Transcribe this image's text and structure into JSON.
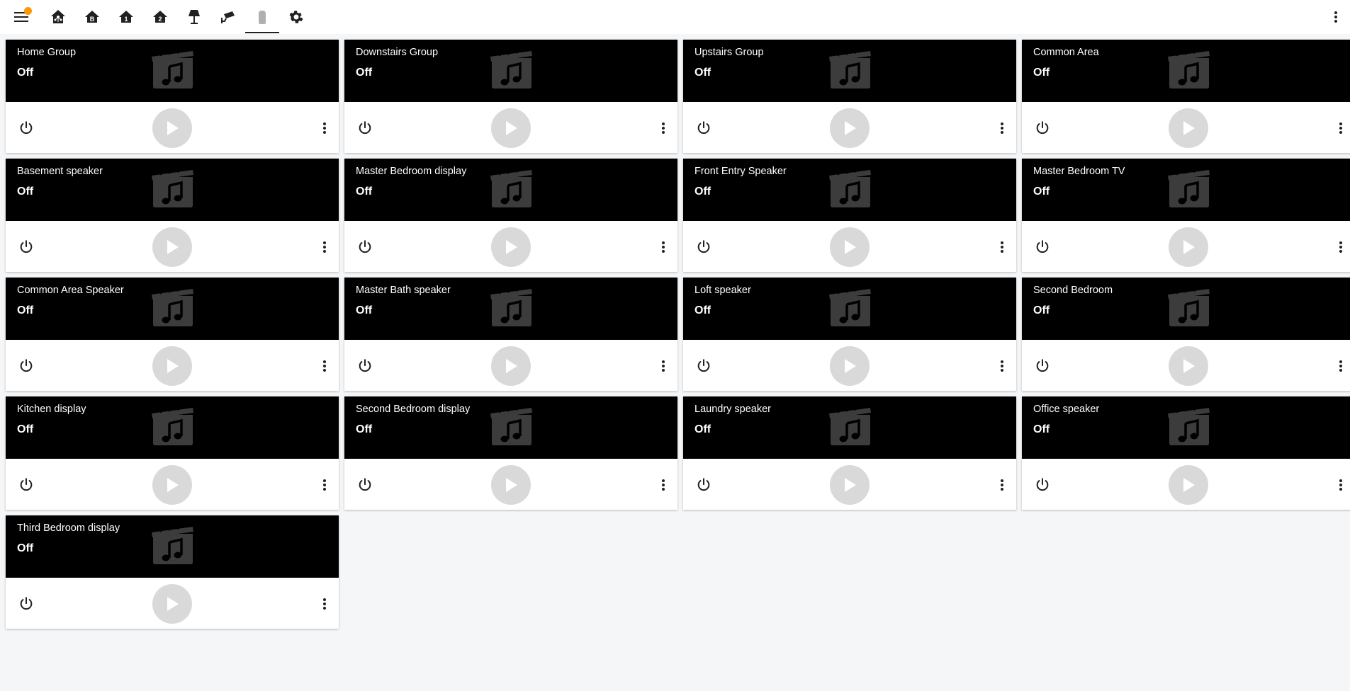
{
  "toolbar": {
    "menu_icon": "menu-icon",
    "has_notification_badge": true,
    "badge_color": "#ff9800",
    "tabs": [
      {
        "icon": "home-assistant-icon",
        "active": false
      },
      {
        "icon": "home-floor-b-icon",
        "active": false
      },
      {
        "icon": "home-floor-1-icon",
        "active": false
      },
      {
        "icon": "home-floor-2-icon",
        "active": false
      },
      {
        "icon": "floor-lamp-icon",
        "active": false
      },
      {
        "icon": "cctv-icon",
        "active": false
      },
      {
        "icon": "speaker-icon",
        "active": true
      },
      {
        "icon": "gear-icon",
        "active": false
      }
    ],
    "overflow_icon": "dots-vertical-icon"
  },
  "media_players": [
    {
      "name": "Home Group",
      "state": "Off"
    },
    {
      "name": "Downstairs Group",
      "state": "Off"
    },
    {
      "name": "Upstairs Group",
      "state": "Off"
    },
    {
      "name": "Common Area",
      "state": "Off"
    },
    {
      "name": "Basement speaker",
      "state": "Off"
    },
    {
      "name": "Master Bedroom display",
      "state": "Off"
    },
    {
      "name": "Front Entry Speaker",
      "state": "Off"
    },
    {
      "name": "Master Bedroom TV",
      "state": "Off"
    },
    {
      "name": "Common Area Speaker",
      "state": "Off"
    },
    {
      "name": "Master Bath speaker",
      "state": "Off"
    },
    {
      "name": "Loft speaker",
      "state": "Off"
    },
    {
      "name": "Second Bedroom",
      "state": "Off"
    },
    {
      "name": "Kitchen display",
      "state": "Off"
    },
    {
      "name": "Second Bedroom display",
      "state": "Off"
    },
    {
      "name": "Laundry speaker",
      "state": "Off"
    },
    {
      "name": "Office speaker",
      "state": "Off"
    },
    {
      "name": "Third Bedroom display",
      "state": "Off"
    }
  ],
  "card_icons": {
    "artwork": "movie-music-icon",
    "power": "power-icon",
    "play": "play-icon",
    "more": "dots-vertical-icon"
  }
}
